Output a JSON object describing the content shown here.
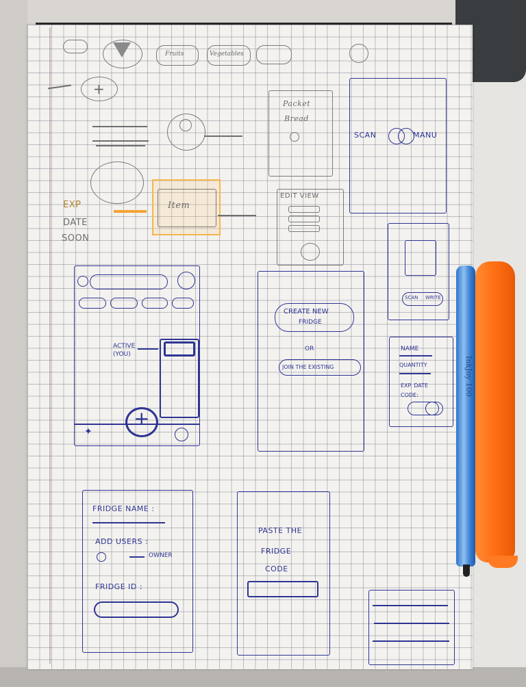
{
  "top_row": {
    "chip_fruits": "Fruits",
    "chip_vegetables": "Vegetables"
  },
  "pantry_sketch": {
    "line1": "Packet",
    "line2": "Bread"
  },
  "scan_sketch": {
    "left": "SCAN",
    "right": "MANU"
  },
  "exp_sketch": {
    "line1": "EXP",
    "line2": "DATE",
    "line3": "SOON",
    "item_label": "Item"
  },
  "edit_sketch": {
    "title": "EDIT VIEW"
  },
  "main_sketch": {
    "active_label": "ACTIVE",
    "you_label": "(YOU)"
  },
  "create_sketch": {
    "create_button": "CREATE NEW",
    "create_button_line2": "FRIDGE",
    "or_text": "OR",
    "join_button": "JOIN THE EXISTING"
  },
  "small_scan_sketch": {
    "scan_label": "SCAN",
    "write_label": "WRITE"
  },
  "form_sketch": {
    "name": "NAME",
    "quantity": "QUANTITY",
    "exp_date": "EXP. DATE",
    "code": "CODE:"
  },
  "fridge_setup_sketch": {
    "fridge_name": "FRIDGE NAME :",
    "add_users": "ADD USERS :",
    "owner": "OWNER",
    "fridge_id": "FRIDGE ID :"
  },
  "paste_sketch": {
    "line1": "PASTE THE",
    "line2": "FRIDGE",
    "line3": "CODE"
  },
  "pen_text": "InkJoy 100"
}
